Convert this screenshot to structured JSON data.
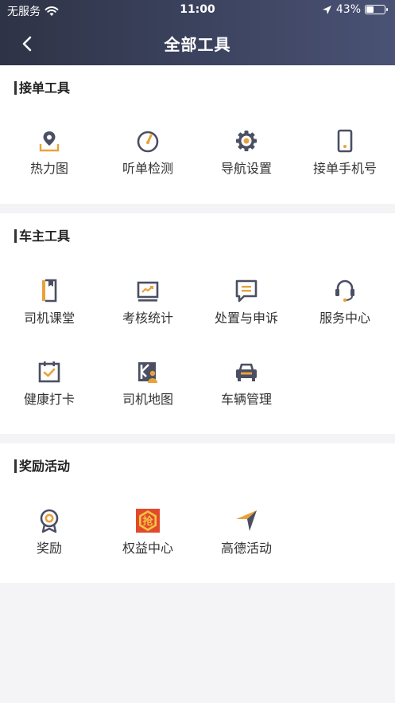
{
  "status_bar": {
    "carrier": "无服务",
    "time": "11:00",
    "battery": "43%",
    "battery_level": 0.43
  },
  "header": {
    "title": "全部工具"
  },
  "colors": {
    "accent": "#e9a23b",
    "icon_dark": "#4a4f63",
    "header_start": "#2e3346",
    "header_end": "#4a5275"
  },
  "sections": [
    {
      "title": "接单工具",
      "items": [
        {
          "label": "热力图",
          "icon": "map-pin-icon"
        },
        {
          "label": "听单检测",
          "icon": "gauge-icon"
        },
        {
          "label": "导航设置",
          "icon": "gear-icon"
        },
        {
          "label": "接单手机号",
          "icon": "phone-icon"
        }
      ]
    },
    {
      "title": "车主工具",
      "items": [
        {
          "label": "司机课堂",
          "icon": "book-icon"
        },
        {
          "label": "考核统计",
          "icon": "stats-chart-icon"
        },
        {
          "label": "处置与申诉",
          "icon": "message-icon"
        },
        {
          "label": "服务中心",
          "icon": "headset-icon"
        },
        {
          "label": "健康打卡",
          "icon": "calendar-check-icon"
        },
        {
          "label": "司机地图",
          "icon": "driver-map-icon"
        },
        {
          "label": "车辆管理",
          "icon": "car-icon"
        }
      ]
    },
    {
      "title": "奖励活动",
      "items": [
        {
          "label": "奖励",
          "icon": "medal-icon"
        },
        {
          "label": "权益中心",
          "icon": "grab-badge-icon",
          "badge_text": "抢"
        },
        {
          "label": "高德活动",
          "icon": "paper-plane-icon"
        }
      ]
    }
  ]
}
